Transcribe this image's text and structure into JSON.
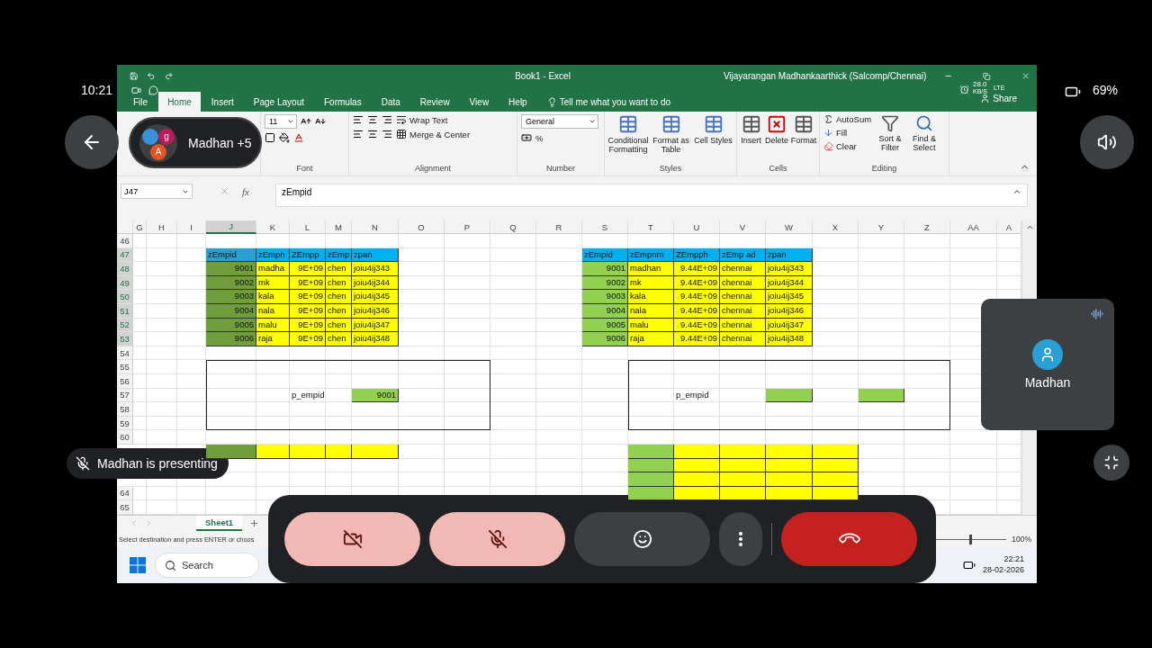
{
  "phone_status": {
    "time": "10:21",
    "battery": "69%",
    "network_speed": "28.0",
    "network_unit": "KB/S",
    "network_type": "LTE"
  },
  "excel": {
    "title": "Book1  -  Excel",
    "user": "Vijayarangan Madhankaarthick (Salcomp/Chennai)",
    "tabs": [
      {
        "label": "File",
        "selected": false
      },
      {
        "label": "Home",
        "selected": true
      },
      {
        "label": "Insert",
        "selected": false
      },
      {
        "label": "Page Layout",
        "selected": false
      },
      {
        "label": "Formulas",
        "selected": false
      },
      {
        "label": "Data",
        "selected": false
      },
      {
        "label": "Review",
        "selected": false
      },
      {
        "label": "View",
        "selected": false
      },
      {
        "label": "Help",
        "selected": false
      }
    ],
    "tell_me": "Tell me what you want to do",
    "share": "Share",
    "ribbon": {
      "font_size": "11",
      "wrap_text": "Wrap Text",
      "merge_center": "Merge & Center",
      "number_format": "General",
      "percent": "%",
      "styles": [
        "Conditional Formatting",
        "Format as Table",
        "Cell Styles"
      ],
      "cells": [
        "Insert",
        "Delete",
        "Format"
      ],
      "editing": {
        "autosum": "AutoSum",
        "fill": "Fill",
        "clear": "Clear",
        "sort": "Sort & Filter",
        "find": "Find & Select"
      },
      "groups": [
        "Font",
        "Alignment",
        "Number",
        "Styles",
        "Cells",
        "Editing"
      ]
    },
    "name_box": "J47",
    "function_label": "fx",
    "formula": "zEmpid",
    "columns": [
      {
        "label": "G",
        "selected": false
      },
      {
        "label": "H",
        "selected": false
      },
      {
        "label": "I",
        "selected": false
      },
      {
        "label": "J",
        "selected": true
      },
      {
        "label": "K",
        "selected": false
      },
      {
        "label": "L",
        "selected": false
      },
      {
        "label": "M",
        "selected": false
      },
      {
        "label": "N",
        "selected": false
      },
      {
        "label": "O",
        "selected": false
      },
      {
        "label": "P",
        "selected": false
      },
      {
        "label": "Q",
        "selected": false
      },
      {
        "label": "R",
        "selected": false
      },
      {
        "label": "S",
        "selected": false
      },
      {
        "label": "T",
        "selected": false
      },
      {
        "label": "U",
        "selected": false
      },
      {
        "label": "V",
        "selected": false
      },
      {
        "label": "W",
        "selected": false
      },
      {
        "label": "X",
        "selected": false
      },
      {
        "label": "Y",
        "selected": false
      },
      {
        "label": "Z",
        "selected": false
      },
      {
        "label": "AA",
        "selected": false
      },
      {
        "label": "A",
        "selected": false
      }
    ],
    "rows": [
      {
        "label": "46",
        "selected": false
      },
      {
        "label": "47",
        "selected": true,
        "cells": [
          {
            "kind": "empty"
          },
          {
            "kind": "empty"
          },
          {
            "kind": "empty"
          },
          {
            "text": "zEmpid",
            "kind": "header",
            "selected": true
          },
          {
            "text": "zEmpn",
            "kind": "header",
            "selected": false
          },
          {
            "text": "ZEmpp",
            "kind": "header",
            "selected": false
          },
          {
            "text": "zEmp",
            "kind": "header",
            "selected": false
          },
          {
            "text": "zpan",
            "kind": "header",
            "selected": false
          },
          {
            "kind": "empty"
          },
          {
            "kind": "empty"
          },
          {
            "kind": "empty"
          },
          {
            "kind": "empty"
          },
          {
            "text": "zEmpid",
            "kind": "header",
            "selected": false
          },
          {
            "text": "zEmpnm",
            "kind": "header",
            "selected": false
          },
          {
            "text": "ZEmpph",
            "kind": "header",
            "selected": false
          },
          {
            "text": "zEmp ad",
            "kind": "header",
            "selected": false
          },
          {
            "text": "zpan",
            "kind": "header",
            "selected": false
          }
        ]
      },
      {
        "label": "48",
        "selected": true,
        "cells": [
          {
            "kind": "empty"
          },
          {
            "kind": "empty"
          },
          {
            "kind": "empty"
          },
          {
            "text": "9001",
            "kind": "id",
            "selected": true
          },
          {
            "text": "madha",
            "kind": "value",
            "selected": false
          },
          {
            "text": "9E+09",
            "kind": "number",
            "selected": false
          },
          {
            "text": "chen",
            "kind": "value",
            "selected": false
          },
          {
            "text": "joiu4ij343",
            "kind": "value",
            "selected": false
          },
          {
            "kind": "empty"
          },
          {
            "kind": "empty"
          },
          {
            "kind": "empty"
          },
          {
            "kind": "empty"
          },
          {
            "text": "9001",
            "kind": "id",
            "selected": false
          },
          {
            "text": "madhan",
            "kind": "value",
            "selected": false
          },
          {
            "text": "9.44E+09",
            "kind": "number",
            "selected": false
          },
          {
            "text": "chennai",
            "kind": "value",
            "selected": false
          },
          {
            "text": "joiu4ij343",
            "kind": "value",
            "selected": false
          }
        ]
      },
      {
        "label": "49",
        "selected": true,
        "cells": [
          {
            "kind": "empty"
          },
          {
            "kind": "empty"
          },
          {
            "kind": "empty"
          },
          {
            "text": "9002",
            "kind": "id",
            "selected": true
          },
          {
            "text": "mk",
            "kind": "value",
            "selected": false
          },
          {
            "text": "9E+09",
            "kind": "number",
            "selected": false
          },
          {
            "text": "chen",
            "kind": "value",
            "selected": false
          },
          {
            "text": "joiu4ij344",
            "kind": "value",
            "selected": false
          },
          {
            "kind": "empty"
          },
          {
            "kind": "empty"
          },
          {
            "kind": "empty"
          },
          {
            "kind": "empty"
          },
          {
            "text": "9002",
            "kind": "id",
            "selected": false
          },
          {
            "text": "mk",
            "kind": "value",
            "selected": false
          },
          {
            "text": "9.44E+09",
            "kind": "number",
            "selected": false
          },
          {
            "text": "chennai",
            "kind": "value",
            "selected": false
          },
          {
            "text": "joiu4ij344",
            "kind": "value",
            "selected": false
          }
        ]
      },
      {
        "label": "50",
        "selected": true,
        "cells": [
          {
            "kind": "empty"
          },
          {
            "kind": "empty"
          },
          {
            "kind": "empty"
          },
          {
            "text": "9003",
            "kind": "id",
            "selected": true
          },
          {
            "text": "kala",
            "kind": "value",
            "selected": false
          },
          {
            "text": "9E+09",
            "kind": "number",
            "selected": false
          },
          {
            "text": "chen",
            "kind": "value",
            "selected": false
          },
          {
            "text": "joiu4ij345",
            "kind": "value",
            "selected": false
          },
          {
            "kind": "empty"
          },
          {
            "kind": "empty"
          },
          {
            "kind": "empty"
          },
          {
            "kind": "empty"
          },
          {
            "text": "9003",
            "kind": "id",
            "selected": false
          },
          {
            "text": "kala",
            "kind": "value",
            "selected": false
          },
          {
            "text": "9.44E+09",
            "kind": "number",
            "selected": false
          },
          {
            "text": "chennai",
            "kind": "value",
            "selected": false
          },
          {
            "text": "joiu4ij345",
            "kind": "value",
            "selected": false
          }
        ]
      },
      {
        "label": "51",
        "selected": true,
        "cells": [
          {
            "kind": "empty"
          },
          {
            "kind": "empty"
          },
          {
            "kind": "empty"
          },
          {
            "text": "9004",
            "kind": "id",
            "selected": true
          },
          {
            "text": "nala",
            "kind": "value",
            "selected": false
          },
          {
            "text": "9E+09",
            "kind": "number",
            "selected": false
          },
          {
            "text": "chen",
            "kind": "value",
            "selected": false
          },
          {
            "text": "joiu4ij346",
            "kind": "value",
            "selected": false
          },
          {
            "kind": "empty"
          },
          {
            "kind": "empty"
          },
          {
            "kind": "empty"
          },
          {
            "kind": "empty"
          },
          {
            "text": "9004",
            "kind": "id",
            "selected": false
          },
          {
            "text": "nala",
            "kind": "value",
            "selected": false
          },
          {
            "text": "9.44E+09",
            "kind": "number",
            "selected": false
          },
          {
            "text": "chennai",
            "kind": "value",
            "selected": false
          },
          {
            "text": "joiu4ij346",
            "kind": "value",
            "selected": false
          }
        ]
      },
      {
        "label": "52",
        "selected": true,
        "cells": [
          {
            "kind": "empty"
          },
          {
            "kind": "empty"
          },
          {
            "kind": "empty"
          },
          {
            "text": "9005",
            "kind": "id",
            "selected": true
          },
          {
            "text": "malu",
            "kind": "value",
            "selected": false
          },
          {
            "text": "9E+09",
            "kind": "number",
            "selected": false
          },
          {
            "text": "chen",
            "kind": "value",
            "selected": false
          },
          {
            "text": "joiu4ij347",
            "kind": "value",
            "selected": false
          },
          {
            "kind": "empty"
          },
          {
            "kind": "empty"
          },
          {
            "kind": "empty"
          },
          {
            "kind": "empty"
          },
          {
            "text": "9005",
            "kind": "id",
            "selected": false
          },
          {
            "text": "malu",
            "kind": "value",
            "selected": false
          },
          {
            "text": "9.44E+09",
            "kind": "number",
            "selected": false
          },
          {
            "text": "chennai",
            "kind": "value",
            "selected": false
          },
          {
            "text": "joiu4ij347",
            "kind": "value",
            "selected": false
          }
        ]
      },
      {
        "label": "53",
        "selected": true,
        "cells": [
          {
            "kind": "empty"
          },
          {
            "kind": "empty"
          },
          {
            "kind": "empty"
          },
          {
            "text": "9006",
            "kind": "id",
            "selected": true
          },
          {
            "text": "raja",
            "kind": "value",
            "selected": false
          },
          {
            "text": "9E+09",
            "kind": "number",
            "selected": false
          },
          {
            "text": "chen",
            "kind": "value",
            "selected": false
          },
          {
            "text": "joiu4ij348",
            "kind": "value",
            "selected": false
          },
          {
            "kind": "empty"
          },
          {
            "kind": "empty"
          },
          {
            "kind": "empty"
          },
          {
            "kind": "empty"
          },
          {
            "text": "9006",
            "kind": "id",
            "selected": false
          },
          {
            "text": "raja",
            "kind": "value",
            "selected": false
          },
          {
            "text": "9.44E+09",
            "kind": "number",
            "selected": false
          },
          {
            "text": "chennai",
            "kind": "value",
            "selected": false
          },
          {
            "text": "joiu4ij348",
            "kind": "value",
            "selected": false
          }
        ]
      },
      {
        "label": "54",
        "selected": false
      },
      {
        "label": "55",
        "selected": false
      },
      {
        "label": "56",
        "selected": false
      },
      {
        "label": "57",
        "selected": false,
        "cells": [
          {
            "kind": "empty"
          },
          {
            "kind": "empty"
          },
          {
            "kind": "empty"
          },
          {
            "kind": "empty"
          },
          {
            "kind": "empty"
          },
          {
            "text": "p_empid",
            "kind": "plain",
            "selected": false
          },
          {
            "kind": "empty"
          },
          {
            "text": "9001",
            "kind": "id",
            "selected": false
          },
          {
            "kind": "empty"
          },
          {
            "kind": "empty"
          },
          {
            "kind": "empty"
          },
          {
            "kind": "empty"
          },
          {
            "kind": "empty"
          },
          {
            "kind": "empty"
          },
          {
            "text": "p_empid",
            "kind": "plain",
            "selected": false
          },
          {
            "kind": "empty"
          },
          {
            "kind": "id",
            "selected": false
          },
          {
            "kind": "empty"
          },
          {
            "kind": "id",
            "selected": false
          }
        ]
      },
      {
        "label": "58",
        "selected": false
      },
      {
        "label": "59",
        "selected": false
      },
      {
        "label": "60",
        "selected": false
      },
      {
        "cells": [
          {
            "kind": "empty"
          },
          {
            "kind": "empty"
          },
          {
            "kind": "empty"
          },
          {
            "kind": "id",
            "selected": true
          },
          {
            "kind": "value",
            "selected": false
          },
          {
            "kind": "value",
            "selected": false
          },
          {
            "kind": "value",
            "selected": false
          },
          {
            "kind": "value",
            "selected": false
          },
          {
            "kind": "empty"
          },
          {
            "kind": "empty"
          },
          {
            "kind": "empty"
          },
          {
            "kind": "empty"
          },
          {
            "kind": "empty"
          },
          {
            "kind": "id",
            "selected": false
          },
          {
            "kind": "value",
            "selected": false
          },
          {
            "kind": "value",
            "selected": false
          },
          {
            "kind": "value",
            "selected": false
          },
          {
            "kind": "value",
            "selected": false
          }
        ]
      },
      {
        "cells": [
          {
            "kind": "empty"
          },
          {
            "kind": "empty"
          },
          {
            "kind": "empty"
          },
          {
            "kind": "empty"
          },
          {
            "kind": "empty"
          },
          {
            "kind": "empty"
          },
          {
            "kind": "empty"
          },
          {
            "kind": "empty"
          },
          {
            "kind": "empty"
          },
          {
            "kind": "empty"
          },
          {
            "kind": "empty"
          },
          {
            "kind": "empty"
          },
          {
            "kind": "empty"
          },
          {
            "kind": "id",
            "selected": false
          },
          {
            "kind": "value",
            "selected": false
          },
          {
            "kind": "value",
            "selected": false
          },
          {
            "kind": "value",
            "selected": false
          },
          {
            "kind": "value",
            "selected": false
          }
        ]
      },
      {
        "cells": [
          {
            "kind": "empty"
          },
          {
            "kind": "empty"
          },
          {
            "kind": "empty"
          },
          {
            "kind": "empty"
          },
          {
            "kind": "empty"
          },
          {
            "kind": "empty"
          },
          {
            "kind": "empty"
          },
          {
            "kind": "empty"
          },
          {
            "kind": "empty"
          },
          {
            "kind": "empty"
          },
          {
            "kind": "empty"
          },
          {
            "kind": "empty"
          },
          {
            "kind": "empty"
          },
          {
            "kind": "id",
            "selected": false
          },
          {
            "kind": "value",
            "selected": false
          },
          {
            "kind": "value",
            "selected": false
          },
          {
            "kind": "value",
            "selected": false
          },
          {
            "kind": "value",
            "selected": false
          }
        ]
      },
      {
        "label": "64",
        "selected": false,
        "cells": [
          {
            "kind": "empty"
          },
          {
            "kind": "empty"
          },
          {
            "kind": "empty"
          },
          {
            "kind": "empty"
          },
          {
            "kind": "empty"
          },
          {
            "kind": "empty"
          },
          {
            "kind": "empty"
          },
          {
            "kind": "empty"
          },
          {
            "kind": "empty"
          },
          {
            "kind": "empty"
          },
          {
            "kind": "empty"
          },
          {
            "kind": "empty"
          },
          {
            "kind": "empty"
          },
          {
            "kind": "id",
            "selected": false
          },
          {
            "kind": "value",
            "selected": false
          },
          {
            "kind": "value",
            "selected": false
          },
          {
            "kind": "value",
            "selected": false
          },
          {
            "kind": "value",
            "selected": false
          }
        ]
      },
      {
        "label": "65",
        "selected": false
      }
    ],
    "shapes": [
      {
        "kind": "rectangle"
      },
      {
        "kind": "rectangle"
      }
    ],
    "sheet_tabs": [
      {
        "label": "Sheet1",
        "selected": true
      }
    ],
    "status_text": "Select destination and press ENTER or choos",
    "zoom": "100%",
    "zoom_slider": {
      "level": 0.5
    },
    "taskbar": {
      "search": "Search",
      "time": "22:21",
      "date": "28-02-2026"
    }
  },
  "meet": {
    "participants_pill": {
      "label": "Madhan +5",
      "avatars": [
        {
          "color": "#3b8fd9"
        },
        {
          "letter": "g",
          "color": "#c2185b"
        },
        {
          "letter": "A",
          "color": "#e8541e"
        }
      ]
    },
    "tile": {
      "name": "Madhan",
      "speaking": true
    },
    "presenting": "Madhan is presenting",
    "controls": [
      {
        "kind": "camera",
        "on": false
      },
      {
        "kind": "mic",
        "on": false
      },
      {
        "kind": "emoji",
        "on": false
      },
      {
        "kind": "more",
        "on": false
      },
      {
        "kind": "end",
        "on": false
      }
    ]
  }
}
